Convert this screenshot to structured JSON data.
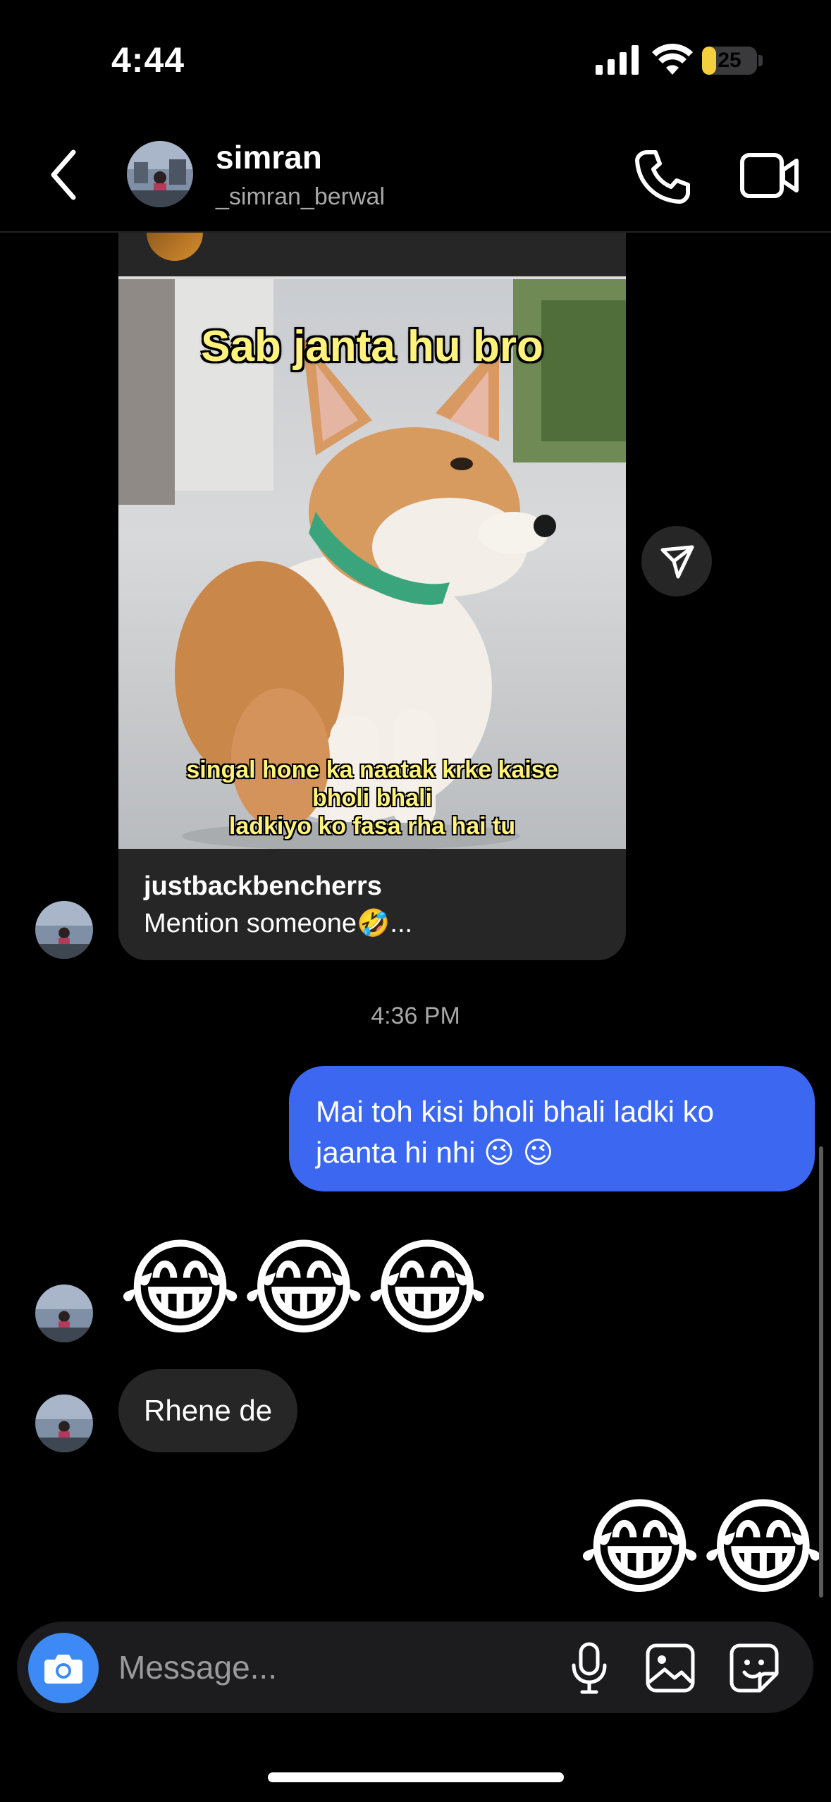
{
  "status_bar": {
    "time": "4:44",
    "battery": "25",
    "battery_level": 0.25
  },
  "header": {
    "name": "simran",
    "handle": "_simran_berwal"
  },
  "shared_post": {
    "meme_top_text": "Sab janta hu bro",
    "meme_bottom_line1": "singal hone ka naatak krke kaise",
    "meme_bottom_line2": "bholi bhali",
    "meme_bottom_line3": "ladkiyo ko fasa rha hai tu",
    "username": "justbackbencherrs",
    "caption": "Mention someone🤣..."
  },
  "timestamp": "4:36 PM",
  "messages": {
    "outgoing_1": "Mai toh kisi bholi bhali ladki ko jaanta hi nhi 😉 😉",
    "incoming_emoji": "😂😂😂",
    "incoming_text": "Rhene de",
    "outgoing_emoji": "😂😂"
  },
  "composer": {
    "placeholder": "Message..."
  },
  "colors": {
    "accent": "#3b67f1",
    "bubble_dark": "#262626",
    "camera_blue": "#3d8af7"
  }
}
